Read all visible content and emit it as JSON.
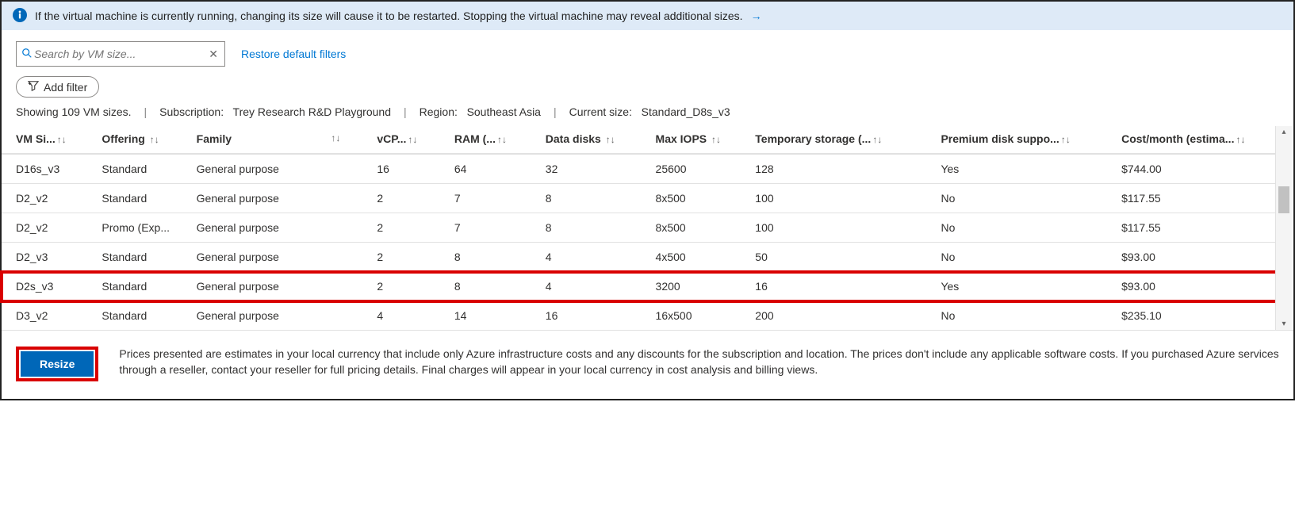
{
  "info_icon": "info-icon",
  "info_text": "If the virtual machine is currently running, changing its size will cause it to be restarted. Stopping the virtual machine may reveal additional sizes.",
  "info_link_arrow": "→",
  "search": {
    "placeholder": "Search by VM size...",
    "value": ""
  },
  "restore_filters_label": "Restore default filters",
  "add_filter_label": "Add filter",
  "summary": {
    "showing": "Showing 109 VM sizes.",
    "subscription_label": "Subscription:",
    "subscription_value": "Trey Research R&D Playground",
    "region_label": "Region:",
    "region_value": "Southeast Asia",
    "current_size_label": "Current size:",
    "current_size_value": "Standard_D8s_v3"
  },
  "columns": [
    "VM Si...",
    "Offering",
    "Family",
    "vCP...",
    "RAM (...",
    "Data disks",
    "Max IOPS",
    "Temporary storage (...",
    "Premium disk suppo...",
    "Cost/month (estima..."
  ],
  "rows": [
    {
      "size": "D16s_v3",
      "offering": "Standard",
      "family": "General purpose",
      "vcpu": "16",
      "ram": "64",
      "disks": "32",
      "iops": "25600",
      "temp": "128",
      "premium": "Yes",
      "cost": "$744.00",
      "hl": false
    },
    {
      "size": "D2_v2",
      "offering": "Standard",
      "family": "General purpose",
      "vcpu": "2",
      "ram": "7",
      "disks": "8",
      "iops": "8x500",
      "temp": "100",
      "premium": "No",
      "cost": "$117.55",
      "hl": false
    },
    {
      "size": "D2_v2",
      "offering": "Promo (Exp...",
      "family": "General purpose",
      "vcpu": "2",
      "ram": "7",
      "disks": "8",
      "iops": "8x500",
      "temp": "100",
      "premium": "No",
      "cost": "$117.55",
      "hl": false
    },
    {
      "size": "D2_v3",
      "offering": "Standard",
      "family": "General purpose",
      "vcpu": "2",
      "ram": "8",
      "disks": "4",
      "iops": "4x500",
      "temp": "50",
      "premium": "No",
      "cost": "$93.00",
      "hl": false
    },
    {
      "size": "D2s_v3",
      "offering": "Standard",
      "family": "General purpose",
      "vcpu": "2",
      "ram": "8",
      "disks": "4",
      "iops": "3200",
      "temp": "16",
      "premium": "Yes",
      "cost": "$93.00",
      "hl": true
    },
    {
      "size": "D3_v2",
      "offering": "Standard",
      "family": "General purpose",
      "vcpu": "4",
      "ram": "14",
      "disks": "16",
      "iops": "16x500",
      "temp": "200",
      "premium": "No",
      "cost": "$235.10",
      "hl": false
    }
  ],
  "footer": {
    "button_label": "Resize",
    "disclaimer": "Prices presented are estimates in your local currency that include only Azure infrastructure costs and any discounts for the subscription and location. The prices don't include any applicable software costs. If you purchased Azure services through a reseller, contact your reseller for full pricing details. Final charges will appear in your local currency in cost analysis and billing views."
  },
  "sort_glyph": "↑↓"
}
